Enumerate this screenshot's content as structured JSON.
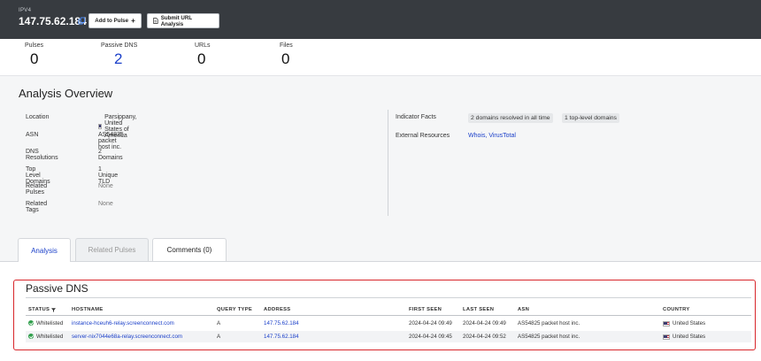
{
  "header": {
    "ip_type": "IPV4",
    "ip_address": "147.75.62.184",
    "add_to_pulse_label": "Add to Pulse",
    "submit_url_label": "Submit URL Analysis"
  },
  "stats": [
    {
      "label": "Pulses",
      "value": "0"
    },
    {
      "label": "Passive DNS",
      "value": "2"
    },
    {
      "label": "URLs",
      "value": "0"
    },
    {
      "label": "Files",
      "value": "0"
    }
  ],
  "overview": {
    "title": "Analysis Overview",
    "rows": [
      {
        "label": "Location",
        "value": "Parsippany, United States of America"
      },
      {
        "label": "ASN",
        "value": "AS54825 packet host inc."
      },
      {
        "label": "DNS Resolutions",
        "value": "2 Domains"
      },
      {
        "label": "Top Level Domains",
        "value": "1 Unique TLD"
      },
      {
        "label": "Related Pulses",
        "value": "None"
      },
      {
        "label": "Related Tags",
        "value": "None"
      }
    ],
    "indicator_facts_label": "Indicator Facts",
    "indicator_facts": [
      "2 domains resolved in all time",
      "1 top-level domains"
    ],
    "external_resources_label": "External Resources",
    "external_resources": "Whois, VirusTotal"
  },
  "tabs": [
    {
      "label": "Analysis"
    },
    {
      "label": "Related Pulses"
    },
    {
      "label": "Comments (0)"
    }
  ],
  "passive_dns": {
    "title": "Passive DNS",
    "columns": [
      "STATUS",
      "HOSTNAME",
      "QUERY TYPE",
      "ADDRESS",
      "FIRST SEEN",
      "LAST SEEN",
      "ASN",
      "COUNTRY"
    ],
    "rows": [
      {
        "status": "Whitelisted",
        "hostname": "instance-hceuh6-relay.screenconnect.com",
        "query_type": "A",
        "address": "147.75.62.184",
        "first_seen": "2024-04-24 09:49",
        "last_seen": "2024-04-24 09:49",
        "asn": "AS54825 packet host inc.",
        "country": "United States"
      },
      {
        "status": "Whitelisted",
        "hostname": "server-nix7044e68a-relay.screenconnect.com",
        "query_type": "A",
        "address": "147.75.62.184",
        "first_seen": "2024-04-24 09:45",
        "last_seen": "2024-04-24 09:52",
        "asn": "AS54825 packet host inc.",
        "country": "United States"
      }
    ]
  },
  "colors": {
    "header_bg": "#373b40",
    "link": "#1a3fc9",
    "highlight_border": "#d8262b",
    "status_ok": "#2e9e4a"
  }
}
